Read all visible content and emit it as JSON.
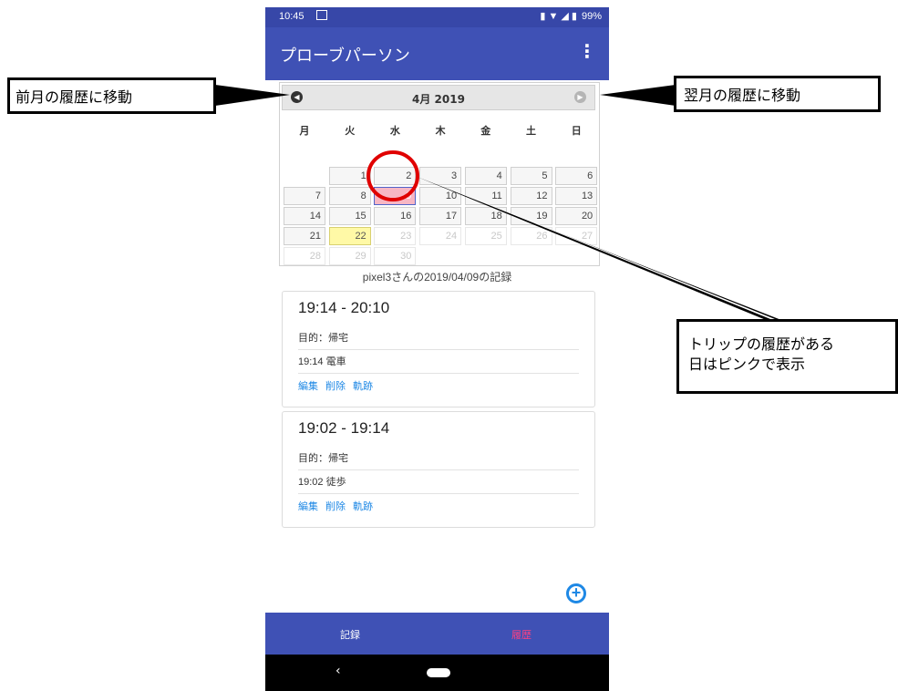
{
  "statusbar": {
    "time": "10:45",
    "icons": "▮ ▼ ◢ ▮",
    "battery": "99%"
  },
  "appbar": {
    "title": "プローブパーソン",
    "menu_icon": "more-vert-icon",
    "menu_glyph": "⋮"
  },
  "calendar": {
    "month_label": "4月 2019",
    "prev_glyph": "◀",
    "next_glyph": "▶",
    "weekdays": [
      "月",
      "火",
      "水",
      "木",
      "金",
      "土",
      "日"
    ],
    "days": [
      "1",
      "2",
      "3",
      "4",
      "5",
      "6",
      "7",
      "8",
      "9",
      "10",
      "11",
      "12",
      "13",
      "14",
      "15",
      "16",
      "17",
      "18",
      "19",
      "20",
      "21",
      "22",
      "23",
      "24",
      "25",
      "26",
      "27",
      "28",
      "29",
      "30"
    ],
    "today": "22",
    "trip_day": "9"
  },
  "record_title": "pixel3さんの2019/04/09の記録",
  "trips": [
    {
      "time": "19:14 - 20:10",
      "purpose": "目的：帰宅",
      "segment": "19:14 電車",
      "edit": "編集",
      "delete": "削除",
      "track": "軌跡"
    },
    {
      "time": "19:02 - 19:14",
      "purpose": "目的：帰宅",
      "segment": "19:02 徒歩",
      "edit": "編集",
      "delete": "削除",
      "track": "軌跡"
    }
  ],
  "fab": {
    "icon": "add-circle-icon",
    "glyph": "+"
  },
  "bottom_nav": {
    "record": "記録",
    "history": "履歴",
    "active_color": "#ff4081",
    "inactive_color": "#ffffff"
  },
  "system_nav": {
    "back_glyph": "‹"
  },
  "annotations": {
    "prev_month": "前月の履歴に移動",
    "next_month": "翌月の履歴に移動",
    "trip_line1": "トリップの履歴がある",
    "trip_line2": "日はピンクで表示"
  },
  "colors": {
    "primary": "#3f51b5",
    "status": "#3747a8",
    "trip_day": "#f7b7c4",
    "today": "#fff9a6",
    "link": "#1e88e5",
    "highlight_circle": "#e00000"
  }
}
